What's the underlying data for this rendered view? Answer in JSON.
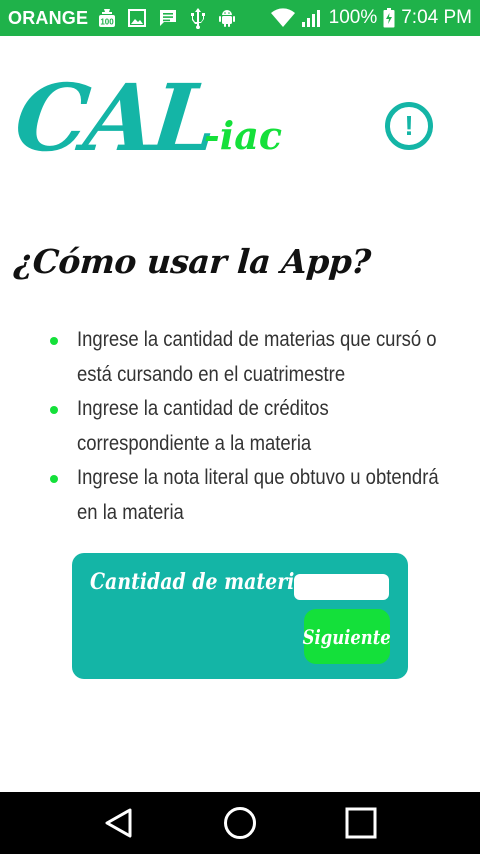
{
  "status_bar": {
    "carrier": "ORANGE",
    "battery": "100%",
    "time": "7:04 PM",
    "left_icons": [
      "100-badge-icon",
      "image-icon",
      "message-icon",
      "usb-icon",
      "android-icon"
    ],
    "right_icons": [
      "wifi-icon",
      "signal-icon",
      "battery-charging-icon"
    ]
  },
  "header": {
    "logo_main": "CAL",
    "logo_suffix": "-iac",
    "info_icon": "!"
  },
  "main": {
    "title": "¿Cómo usar la App?",
    "instructions": [
      "Ingrese la cantidad de materias que cursó o está cursando en el cuatrimestre",
      "Ingrese la cantidad de créditos correspondiente a la materia",
      "Ingrese la nota literal que obtuvo u obtendrá en la materia"
    ],
    "form": {
      "label": "Cantidad de materias:",
      "input_value": "",
      "input_placeholder": "",
      "next_button": "Siguiente"
    }
  },
  "navigation": {
    "items": [
      "back-icon",
      "home-icon",
      "recent-apps-icon"
    ]
  },
  "colors": {
    "status_bar": "#1fb24a",
    "brand_teal": "#14b5a6",
    "accent_green": "#14e03a",
    "text": "#111111",
    "navigation": "#000000"
  }
}
